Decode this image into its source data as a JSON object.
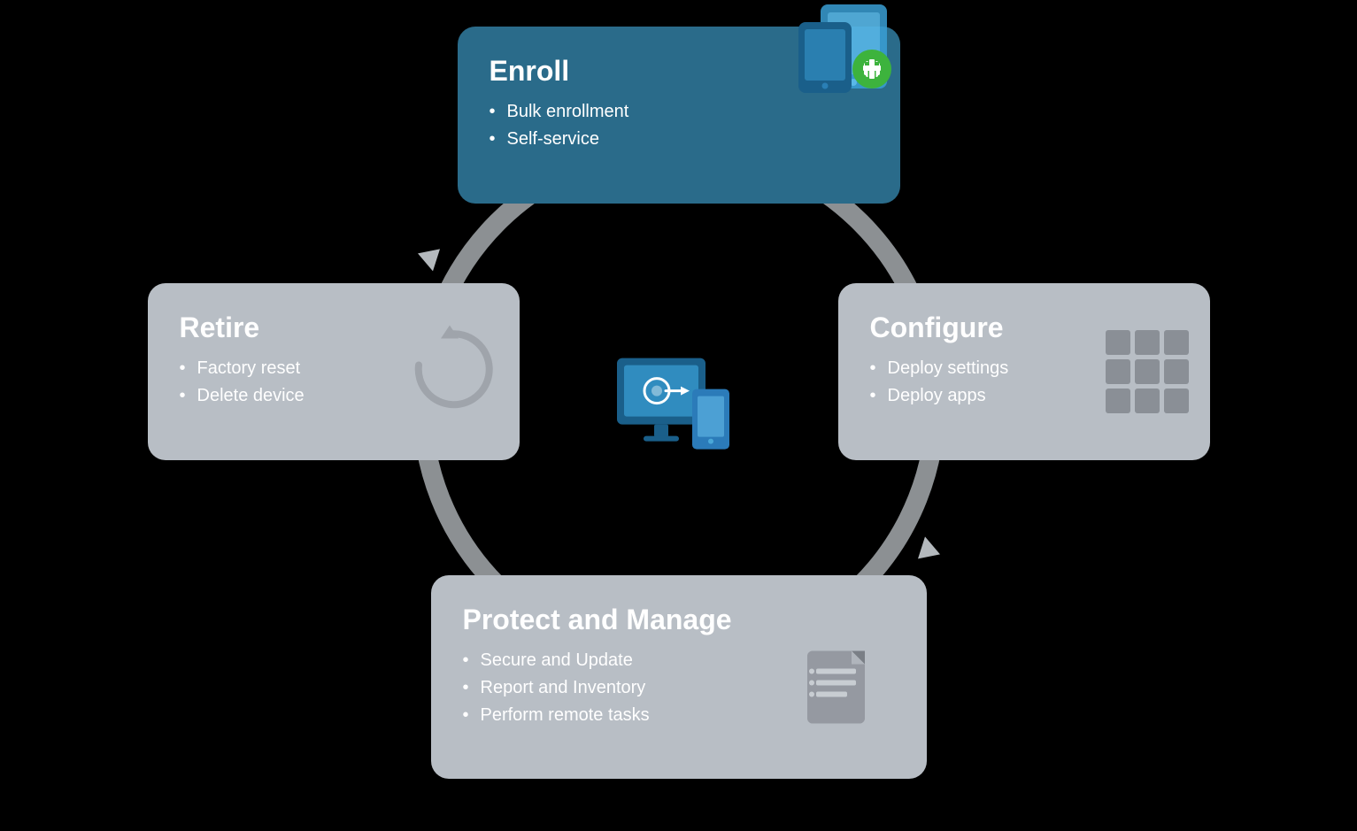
{
  "cards": {
    "enroll": {
      "title": "Enroll",
      "items": [
        "Bulk enrollment",
        "Self-service"
      ],
      "bg": "#2a6b8a"
    },
    "configure": {
      "title": "Configure",
      "items": [
        "Deploy settings",
        "Deploy apps"
      ],
      "bg": "#b8bec5"
    },
    "protect": {
      "title": "Protect and Manage",
      "items": [
        "Secure and Update",
        "Report and Inventory",
        "Perform remote tasks"
      ],
      "bg": "#b8bec5"
    },
    "retire": {
      "title": "Retire",
      "items": [
        "Factory reset",
        "Delete device"
      ],
      "bg": "#b8bec5"
    }
  },
  "colors": {
    "enroll_bg": "#2a6b8a",
    "card_bg": "#b8bec5",
    "arrow": "#c8cdd2",
    "white": "#ffffff",
    "icon_blue": "#2b7bb9",
    "icon_green": "#3db33d",
    "icon_gray": "#9a9fa5"
  }
}
